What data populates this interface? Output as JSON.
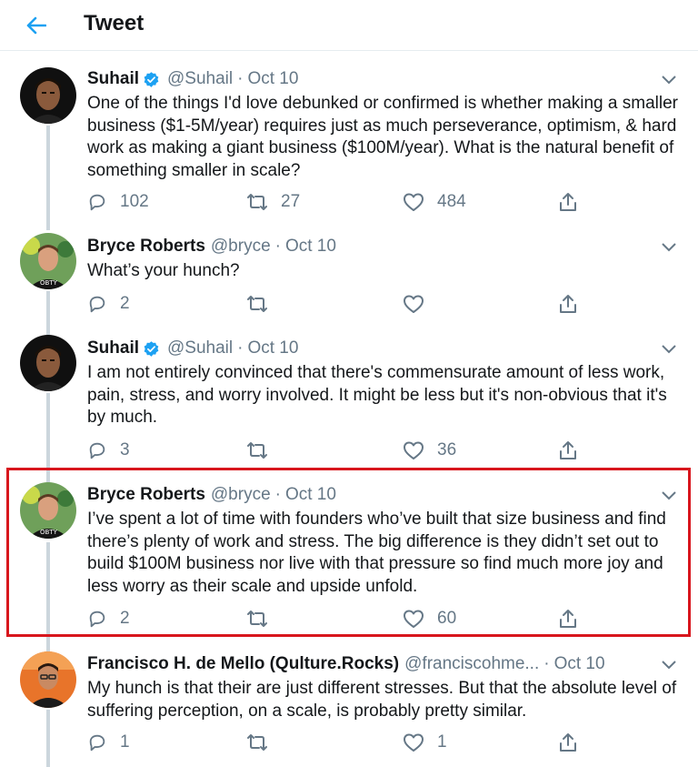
{
  "header": {
    "title": "Tweet"
  },
  "colors": {
    "accent": "#1da1f2",
    "highlight": "#d8161d",
    "muted": "#657786",
    "text": "#14171a"
  },
  "tweets": [
    {
      "name": "Suhail",
      "verified": true,
      "handle": "@Suhail",
      "sep": "·",
      "date": "Oct 10",
      "text": "One of the things I'd love debunked or confirmed is whether making a smaller business ($1-5M/year) requires just as much perseverance, optimism, & hard work as making a giant business ($100M/year). What is the natural benefit of something smaller in scale?",
      "replies": "102",
      "retweets": "27",
      "likes": "484"
    },
    {
      "name": "Bryce Roberts",
      "verified": false,
      "handle": "@bryce",
      "sep": "·",
      "date": "Oct 10",
      "text": "What’s your hunch?",
      "replies": "2",
      "retweets": "",
      "likes": ""
    },
    {
      "name": "Suhail",
      "verified": true,
      "handle": "@Suhail",
      "sep": "·",
      "date": "Oct 10",
      "text": "I am not entirely convinced that there's commensurate amount of less work, pain, stress, and worry involved. It might be less but it's non-obvious that it's by much.",
      "replies": "3",
      "retweets": "",
      "likes": "36"
    },
    {
      "name": "Bryce Roberts",
      "verified": false,
      "handle": "@bryce",
      "sep": "·",
      "date": "Oct 10",
      "text": "I’ve spent a lot of time with founders who’ve built that size business and find there’s plenty of work and stress. The big difference is they didn’t set out to build $100M business nor live with that pressure so find much more joy and less worry as their scale and upside unfold.",
      "replies": "2",
      "retweets": "",
      "likes": "60"
    },
    {
      "name": "Francisco H. de Mello (Qulture.Rocks)",
      "verified": false,
      "handle": "@franciscohme...",
      "sep": "·",
      "date": "Oct 10",
      "text": "My hunch is that their are just different stresses. But that the absolute level of suffering perception, on a scale, is probably pretty similar.",
      "replies": "1",
      "retweets": "",
      "likes": "1"
    }
  ],
  "icons": {
    "back": "arrow-left-icon",
    "caret": "chevron-down-icon",
    "reply": "reply-icon",
    "retweet": "retweet-icon",
    "like": "heart-icon",
    "share": "share-icon",
    "verified": "verified-badge-icon"
  }
}
